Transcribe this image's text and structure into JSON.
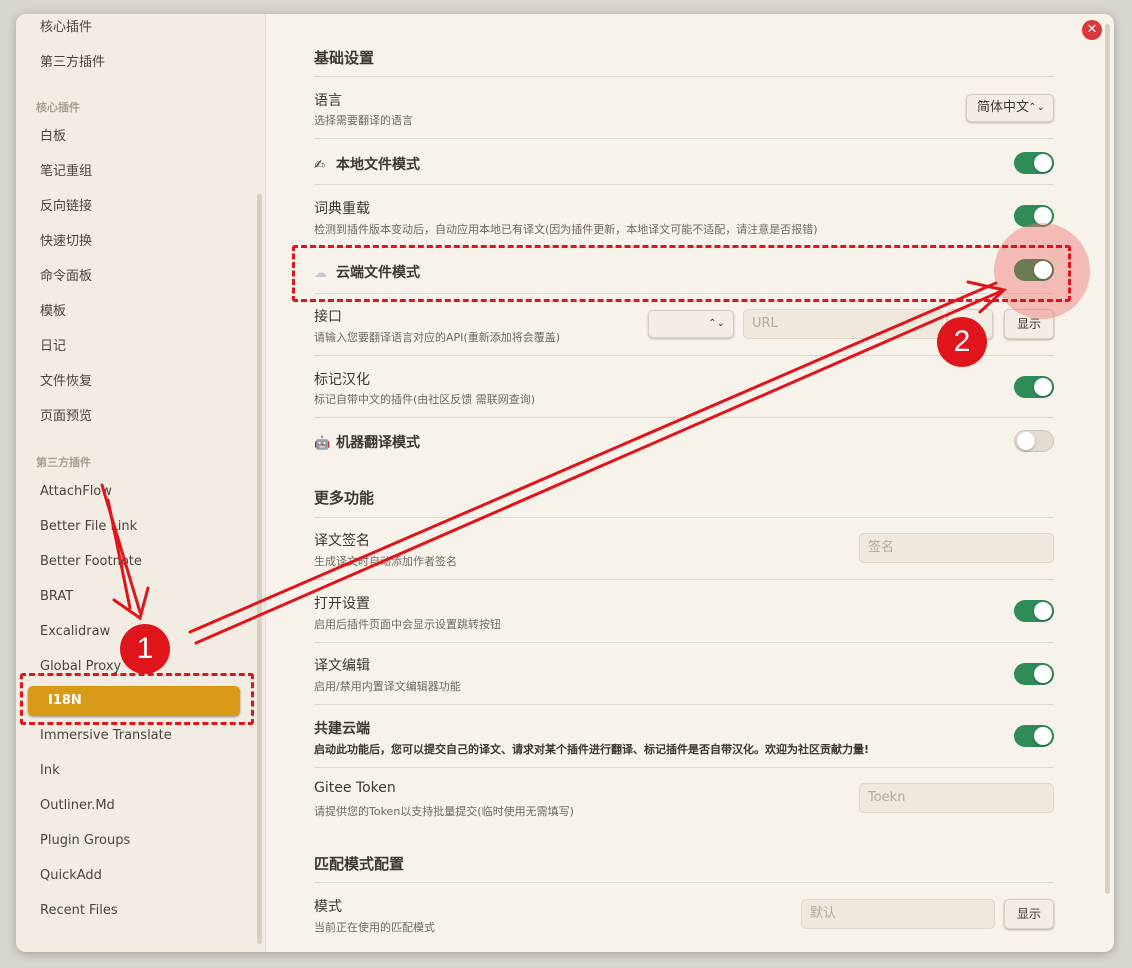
{
  "sidebar": {
    "top_items": [
      "核心插件",
      "第三方插件"
    ],
    "core_header": "核心插件",
    "core_items": [
      "白板",
      "笔记重组",
      "反向链接",
      "快速切换",
      "命令面板",
      "模板",
      "日记",
      "文件恢复",
      "页面预览"
    ],
    "third_header": "第三方插件",
    "third_items": [
      "AttachFlow",
      "Better File Link",
      "Better Footnote",
      "BRAT",
      "Excalidraw",
      "Global Proxy"
    ],
    "active_item": "I18N",
    "after_items": [
      "Immersive Translate",
      "Ink",
      "Outliner.Md",
      "Plugin Groups",
      "QuickAdd",
      "Recent Files"
    ]
  },
  "close_icon": "close-icon",
  "basic": {
    "title": "基础设置",
    "language": {
      "name": "语言",
      "desc": "选择需要翻译的语言",
      "value": "简体中文"
    },
    "local_mode": {
      "name": "本地文件模式",
      "icon": "pencil-icon",
      "enabled": true
    },
    "dict_reload": {
      "name": "词典重载",
      "desc": "检测到插件版本变动后，自动应用本地已有译文(因为插件更新，本地译文可能不适配，请注意是否报错)",
      "enabled": true
    },
    "cloud_mode": {
      "name": "云端文件模式",
      "icon": "cloud-icon",
      "enabled": true
    },
    "api": {
      "name": "接口",
      "desc": "请输入您要翻译语言对应的API(重新添加将会覆盖)",
      "url_placeholder": "URL",
      "show_label": "显示"
    },
    "mark": {
      "name": "标记汉化",
      "desc": "标记自带中文的插件(由社区反馈 需联网查询)",
      "enabled": true
    },
    "machine": {
      "name": "机器翻译模式",
      "icon": "robot-icon",
      "enabled": false
    }
  },
  "more": {
    "title": "更多功能",
    "signature": {
      "name": "译文签名",
      "desc": "生成译文时自动添加作者签名",
      "placeholder": "签名"
    },
    "open_settings": {
      "name": "打开设置",
      "desc": "启用后插件页面中会显示设置跳转按钮",
      "enabled": true
    },
    "editor": {
      "name": "译文编辑",
      "desc": "启用/禁用内置译文编辑器功能",
      "enabled": true
    },
    "co_cloud": {
      "name": "共建云端",
      "desc": "启动此功能后，您可以提交自己的译文、请求对某个插件进行翻译、标记插件是否自带汉化。欢迎为社区贡献力量!",
      "enabled": true
    },
    "gitee": {
      "name": "Gitee Token",
      "desc": "请提供您的Token以支持批量提交(临时使用无需填写)",
      "placeholder": "Toekn"
    }
  },
  "match": {
    "title": "匹配模式配置",
    "mode": {
      "name": "模式",
      "desc": "当前正在使用的匹配模式",
      "placeholder": "默认",
      "show_label": "显示"
    }
  },
  "annotations": {
    "step1": "1",
    "step2": "2",
    "color": "#e0151b"
  }
}
